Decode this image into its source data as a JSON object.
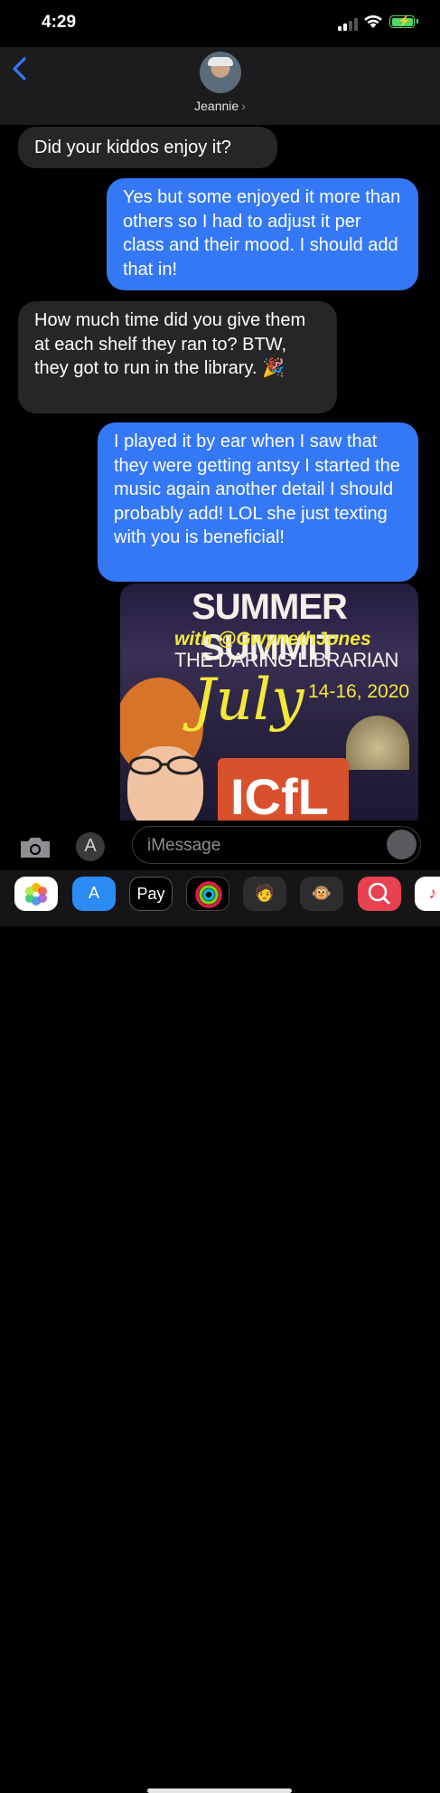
{
  "status": {
    "time": "4:29"
  },
  "header": {
    "contact_name": "Jeannie",
    "chevron": "›"
  },
  "messages": [
    {
      "direction": "received",
      "text": "Did your kiddos enjoy it?"
    },
    {
      "direction": "sent",
      "text": "Yes but some enjoyed it more than others so I had to adjust it per class and their mood. I should add that in!"
    },
    {
      "direction": "received",
      "text": "How much time did you give them at each shelf they ran to? BTW, they got to run in the library. 🎉"
    },
    {
      "direction": "sent",
      "text": "I played it by ear when I saw that they were getting antsy I started the music again another detail I should probably add! LOL she just texting with you is beneficial!"
    }
  ],
  "image_message": {
    "title": "SUMMER SUMMIT",
    "with_line": "with @GwynethJones",
    "subtitle": "THE DARING LIBRARIAN",
    "month": "July",
    "dates": "14-16, 2020",
    "logo": "ICfL"
  },
  "input": {
    "placeholder": "iMessage"
  },
  "app_drawer": {
    "items": [
      "photos-app",
      "app-store",
      "apple-pay",
      "activity",
      "memoji",
      "animoji-monkey",
      "web-search",
      "music"
    ],
    "pay_label": "Pay"
  },
  "colors": {
    "sent_bubble": "#3478f6",
    "received_bubble": "#262628",
    "battery": "#4cd964"
  }
}
